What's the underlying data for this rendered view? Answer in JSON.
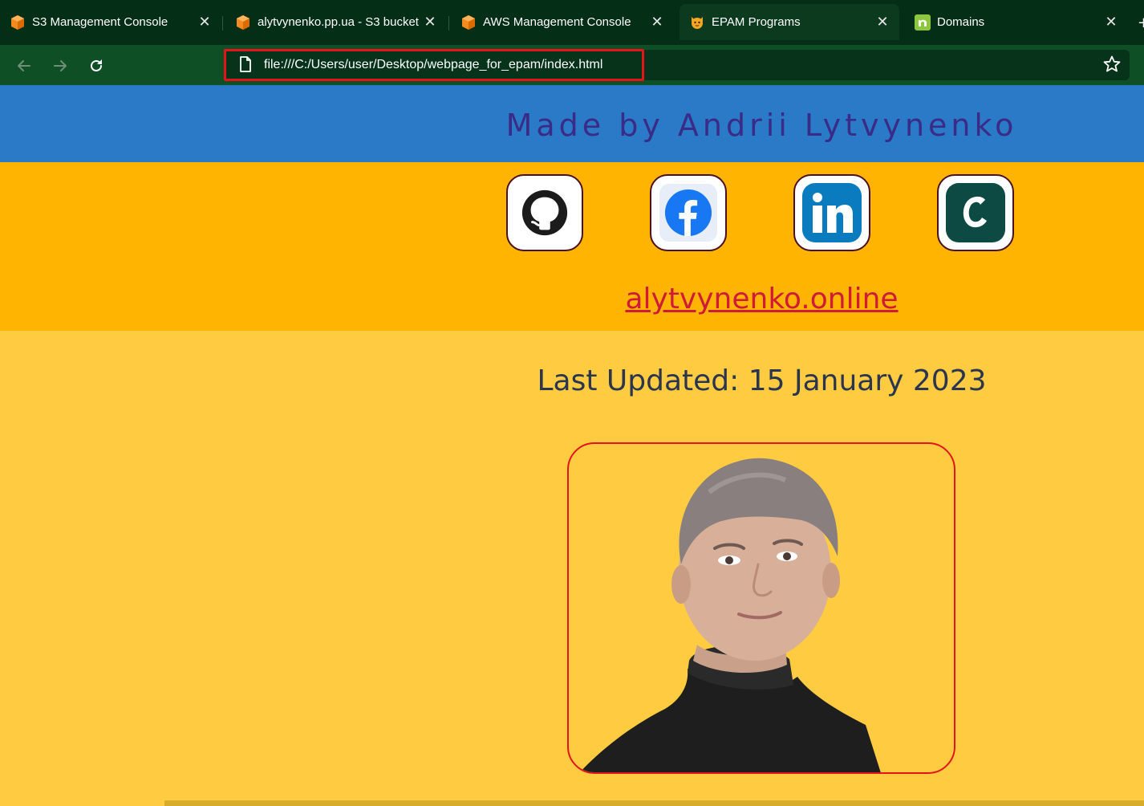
{
  "browser": {
    "tabs": [
      {
        "label": "S3 Management Console",
        "icon": "aws-cube-icon"
      },
      {
        "label": "alytvynenko.pp.ua - S3 bucket",
        "icon": "aws-cube-icon"
      },
      {
        "label": "AWS Management Console",
        "icon": "aws-cube-icon"
      },
      {
        "label": "EPAM Programs",
        "icon": "cat-face-icon",
        "active": true
      },
      {
        "label": "Domains",
        "icon": "namecheap-n-icon"
      }
    ],
    "url": "file:///C:/Users/user/Desktop/webpage_for_epam/index.html"
  },
  "page": {
    "header_title": "Made by Andrii Lytvynenko",
    "social_links": [
      {
        "name": "GitHub",
        "icon": "github-icon"
      },
      {
        "name": "Facebook",
        "icon": "facebook-icon"
      },
      {
        "name": "LinkedIn",
        "icon": "linkedin-icon"
      },
      {
        "name": "Credly",
        "icon": "credly-icon"
      }
    ],
    "site_link": "alytvynenko.online",
    "last_updated": "Last Updated: 15 January 2023"
  },
  "colors": {
    "tab_strip": "#052e16",
    "toolbar": "#0f4f25",
    "header_band": "#2a7ac8",
    "header_text": "#3a2b86",
    "social_band": "#ffb401",
    "page_background": "#ffcb40",
    "link": "#d11a37",
    "highlight_border": "#e5141b"
  }
}
